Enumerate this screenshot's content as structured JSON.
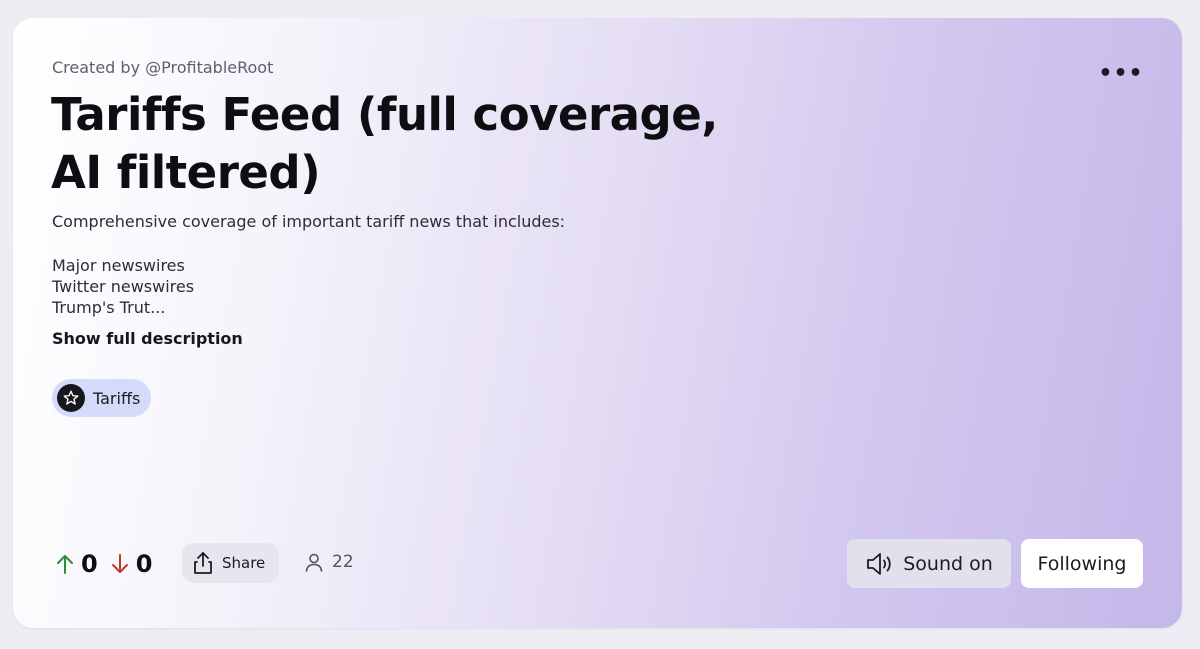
{
  "feed": {
    "creator": "Created by @ProfitableRoot",
    "title": "Tariffs Feed (full coverage, AI filtered)",
    "description_intro": "Comprehensive coverage of important tariff news that includes:",
    "description_lines": [
      "Major newswires",
      "Twitter newswires",
      "Trump's Trut..."
    ],
    "show_full_label": "Show full description"
  },
  "tag": {
    "label": "Tariffs",
    "icon": "star-icon"
  },
  "stats": {
    "upvotes": "0",
    "downvotes": "0",
    "share_label": "Share",
    "followers": "22"
  },
  "actions": {
    "sound_label": "Sound on",
    "follow_label": "Following",
    "more_icon": "more-horizontal-icon"
  },
  "colors": {
    "upvote": "#2e8b3a",
    "downvote": "#c0392b",
    "tag_bg": "#d4dafa",
    "gradient_end": "#c4b7ea"
  }
}
